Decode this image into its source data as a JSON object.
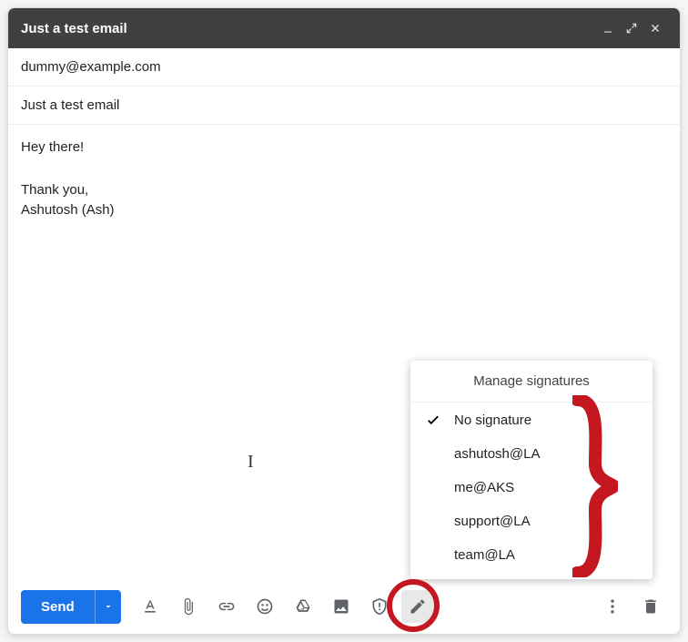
{
  "titlebar": {
    "title": "Just a test email"
  },
  "recipients": {
    "to": "dummy@example.com"
  },
  "subject": {
    "value": "Just a test email"
  },
  "body": {
    "greeting": "Hey there!",
    "signoff": "Thank you,",
    "name": "Ashutosh (Ash)"
  },
  "toolbar": {
    "send_label": "Send"
  },
  "signature_popup": {
    "header": "Manage signatures",
    "items": [
      {
        "label": "No signature",
        "checked": true
      },
      {
        "label": "ashutosh@LA",
        "checked": false
      },
      {
        "label": "me@AKS",
        "checked": false
      },
      {
        "label": "support@LA",
        "checked": false
      },
      {
        "label": "team@LA",
        "checked": false
      }
    ]
  }
}
